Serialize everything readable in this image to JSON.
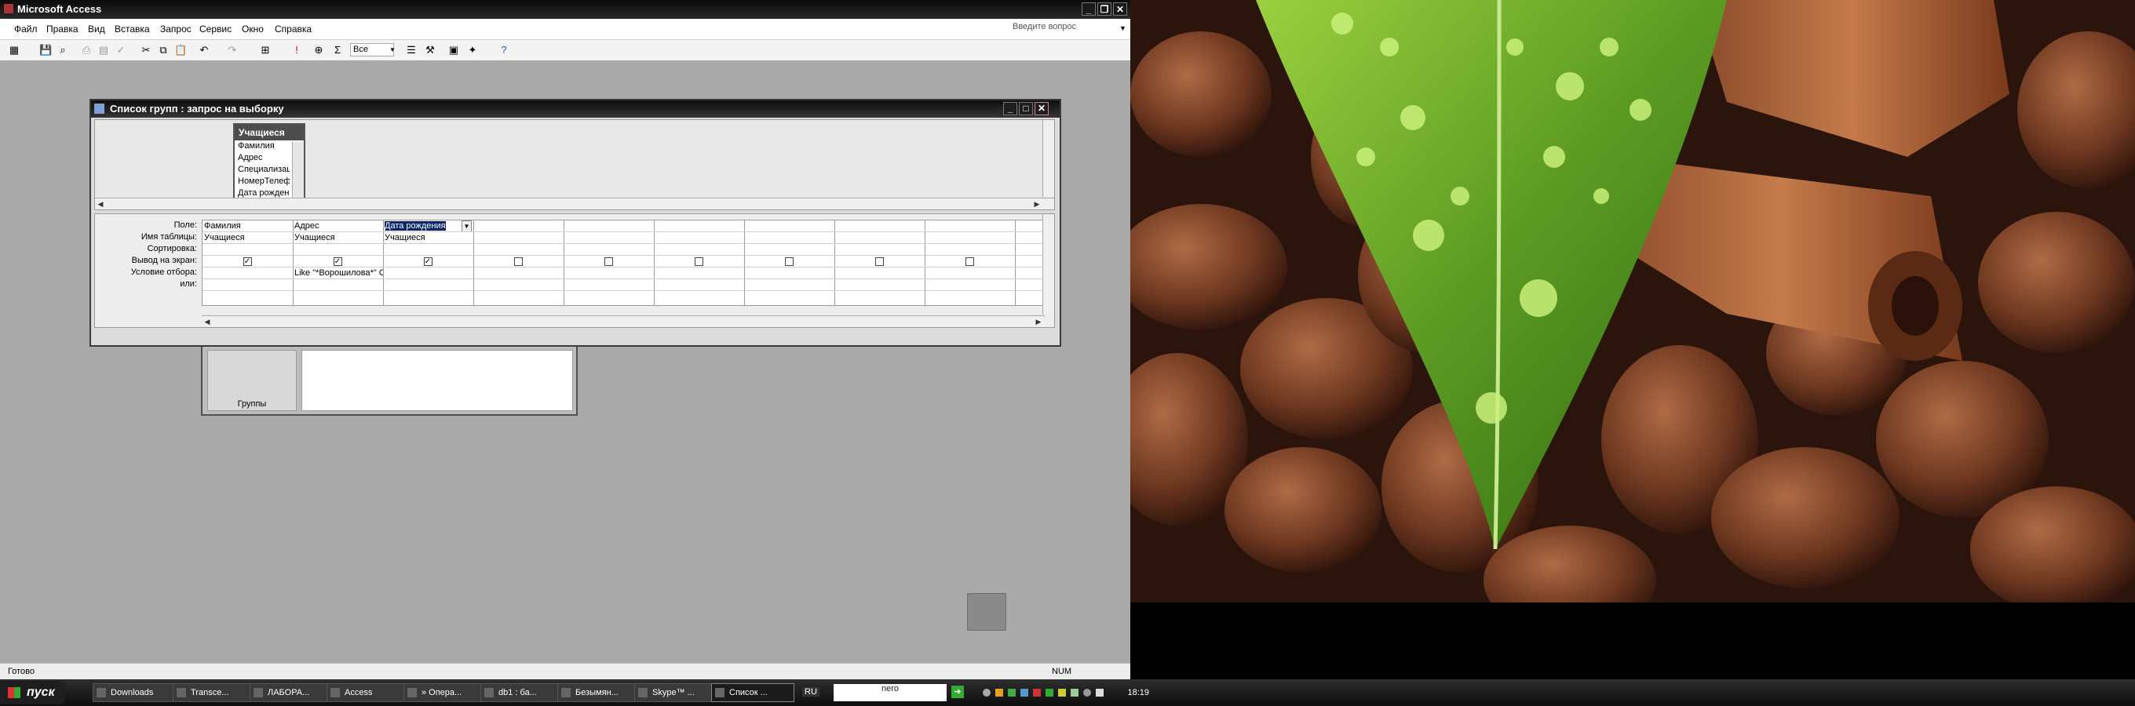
{
  "app": {
    "title": "Microsoft Access",
    "window_buttons": [
      "_",
      "❐",
      "✕"
    ]
  },
  "menu": {
    "items": [
      "Файл",
      "Правка",
      "Вид",
      "Вставка",
      "Запрос",
      "Сервис",
      "Окно",
      "Справка"
    ],
    "help_placeholder": "Введите вопрос"
  },
  "toolbar": {
    "top_values": "Все",
    "sigma": "Σ"
  },
  "query_window": {
    "title": "Список групп : запрос на выборку",
    "table_box": {
      "title": "Учащиеся",
      "fields": [
        "Фамилия",
        "Адрес",
        "Специализация",
        "НомерТелефона",
        "Дата рождения"
      ]
    },
    "row_labels": [
      "Поле:",
      "Имя таблицы:",
      "Сортировка:",
      "Вывод на экран:",
      "Условие отбора:",
      "или:"
    ],
    "columns": [
      {
        "field": "Фамилия",
        "table": "Учащиеся",
        "sort": "",
        "show": true,
        "criteria": "",
        "or": ""
      },
      {
        "field": "Адрес",
        "table": "Учащиеся",
        "sort": "",
        "show": true,
        "criteria": "Like \"*Ворошилова*\" О",
        "or": ""
      },
      {
        "field": "Дата рождения",
        "table": "Учащиеся",
        "sort": "",
        "show": true,
        "criteria": "",
        "or": ""
      },
      {
        "field": "",
        "table": "",
        "sort": "",
        "show": false,
        "criteria": "",
        "or": ""
      },
      {
        "field": "",
        "table": "",
        "sort": "",
        "show": false,
        "criteria": "",
        "or": ""
      },
      {
        "field": "",
        "table": "",
        "sort": "",
        "show": false,
        "criteria": "",
        "or": ""
      },
      {
        "field": "",
        "table": "",
        "sort": "",
        "show": false,
        "criteria": "",
        "or": ""
      },
      {
        "field": "",
        "table": "",
        "sort": "",
        "show": false,
        "criteria": "",
        "or": ""
      },
      {
        "field": "",
        "table": "",
        "sort": "",
        "show": false,
        "criteria": "",
        "or": ""
      },
      {
        "field": "",
        "table": "",
        "sort": "",
        "show": false,
        "criteria": "",
        "or": ""
      }
    ]
  },
  "background_window": {
    "label": "Группы"
  },
  "status": {
    "left": "Готово",
    "right": "NUM"
  },
  "taskbar": {
    "start": "пуск",
    "tasks": [
      "Downloads",
      "Transce...",
      "ЛАБОРА...",
      "Access",
      "» Опера...",
      "db1 : ба...",
      "Безымян...",
      "Skype™ ...",
      "Список ..."
    ],
    "lang": "RU",
    "nero": "nero",
    "clock": "18:19"
  },
  "colors": {
    "accent": "#0a246a",
    "workspace": "#a9a9a9",
    "leaf_green": "#6aa82a"
  }
}
